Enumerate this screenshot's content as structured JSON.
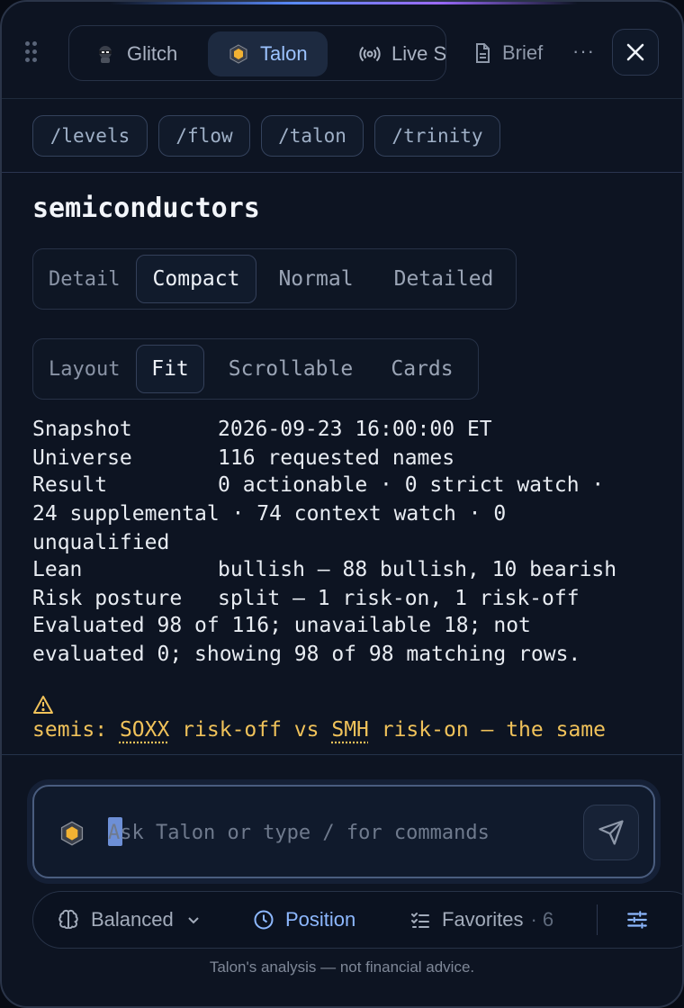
{
  "tabs": [
    {
      "label": "Glitch",
      "icon": "ninja-icon"
    },
    {
      "label": "Talon",
      "icon": "talon-cube-icon"
    },
    {
      "label": "Live S",
      "icon": "broadcast-icon"
    }
  ],
  "brief_label": "Brief",
  "more_label": "···",
  "commands": [
    "/levels",
    "/flow",
    "/talon",
    "/trinity"
  ],
  "title": "semiconductors",
  "detail_control": {
    "label": "Detail",
    "options": [
      "Compact",
      "Normal",
      "Detailed"
    ],
    "selected": "Compact"
  },
  "layout_control": {
    "label": "Layout",
    "options": [
      "Fit",
      "Scrollable",
      "Cards"
    ],
    "selected": "Fit"
  },
  "summary": {
    "snapshot_key": "Snapshot",
    "snapshot_val": "2026-09-23 16:00:00 ET",
    "universe_key": "Universe",
    "universe_val": "116 requested names",
    "result_key": "Result",
    "result_line1": "0 actionable · 0 strict watch ·",
    "result_line2": "24 supplemental · 74 context watch · 0",
    "result_line3": "unqualified",
    "lean_key": "Lean",
    "lean_val": "bullish — 88 bullish, 10 bearish",
    "risk_key": "Risk posture",
    "risk_val": "split — 1 risk-on, 1 risk-off",
    "evaluated_line1": "Evaluated 98 of 116; unavailable 18; not",
    "evaluated_line2": "evaluated 0; showing 98 of 98 matching rows."
  },
  "warning": {
    "prefix": "semis: ",
    "ticker1": "SOXX",
    "mid": " risk-off vs ",
    "ticker2": "SMH",
    "suffix": " risk-on — the same"
  },
  "input": {
    "placeholder": "Ask Talon or type / for commands",
    "value": ""
  },
  "toolbar": {
    "mode_label": "Balanced",
    "position_label": "Position",
    "favorites_label": "Favorites",
    "favorites_count": "· 6"
  },
  "disclaimer": "Talon's analysis — not financial advice.",
  "colors": {
    "accent": "#8db8ff",
    "warning": "#f0c25a",
    "background": "#0d1422"
  }
}
